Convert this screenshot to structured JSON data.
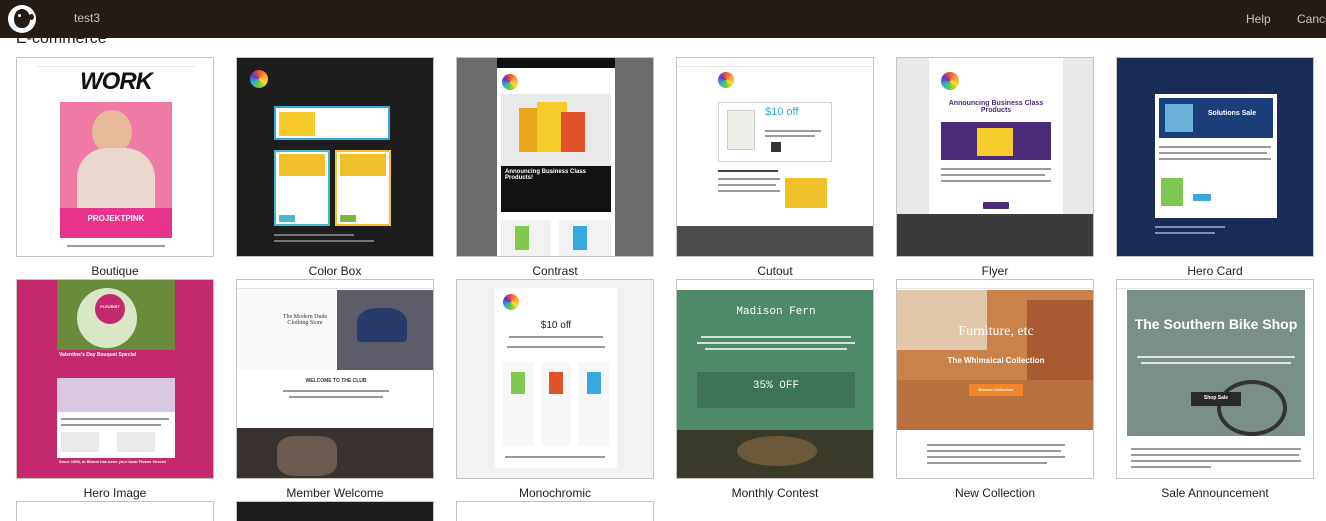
{
  "topbar": {
    "campaign_name": "test3",
    "help": "Help",
    "cancel": "Cancel"
  },
  "section": {
    "title": "E-commerce"
  },
  "templates": [
    {
      "name": "Boutique"
    },
    {
      "name": "Color Box"
    },
    {
      "name": "Contrast"
    },
    {
      "name": "Cutout"
    },
    {
      "name": "Flyer"
    },
    {
      "name": "Hero Card"
    },
    {
      "name": "Hero Image"
    },
    {
      "name": "Member Welcome"
    },
    {
      "name": "Monochromic"
    },
    {
      "name": "Monthly Contest"
    },
    {
      "name": "New Collection"
    },
    {
      "name": "Sale Announcement"
    }
  ],
  "thumb_text": {
    "boutique_logo": "WORK",
    "boutique_brand": "PROJEKTPINK",
    "cutout_offer": "$10 off",
    "flyer_headline": "Announcing Business Class Products",
    "herocard_headline": "Solutions Sale",
    "heroimage_brand": "FLEURIST",
    "heroimage_headline": "Valentine's Day Bouquet Special",
    "heroimage_since": "Since 1995, In Bloom has been your local Flower Heroes",
    "member_store": "The Modern Dude Clothing Store",
    "member_welcome": "WELCOME TO THE CLUB",
    "mono_offer": "$10 off",
    "monthly_name": "Madison Fern",
    "monthly_offer": "35% OFF",
    "newcoll_title": "Furniture, etc",
    "newcoll_sub": "The Whimsical Collection",
    "newcoll_btn": "Browse Collection",
    "sale_title": "The Southern Bike Shop",
    "sale_btn": "Shop Sale",
    "contrast_headline": "Announcing Business Class Products!"
  },
  "colors": {
    "topbar": "#241c15",
    "pink": "#e8338a",
    "magenta": "#c4296e",
    "navy": "#1a2b56",
    "green": "#4d8a6a",
    "purple": "#4b2a7a",
    "orange": "#f2842a"
  }
}
